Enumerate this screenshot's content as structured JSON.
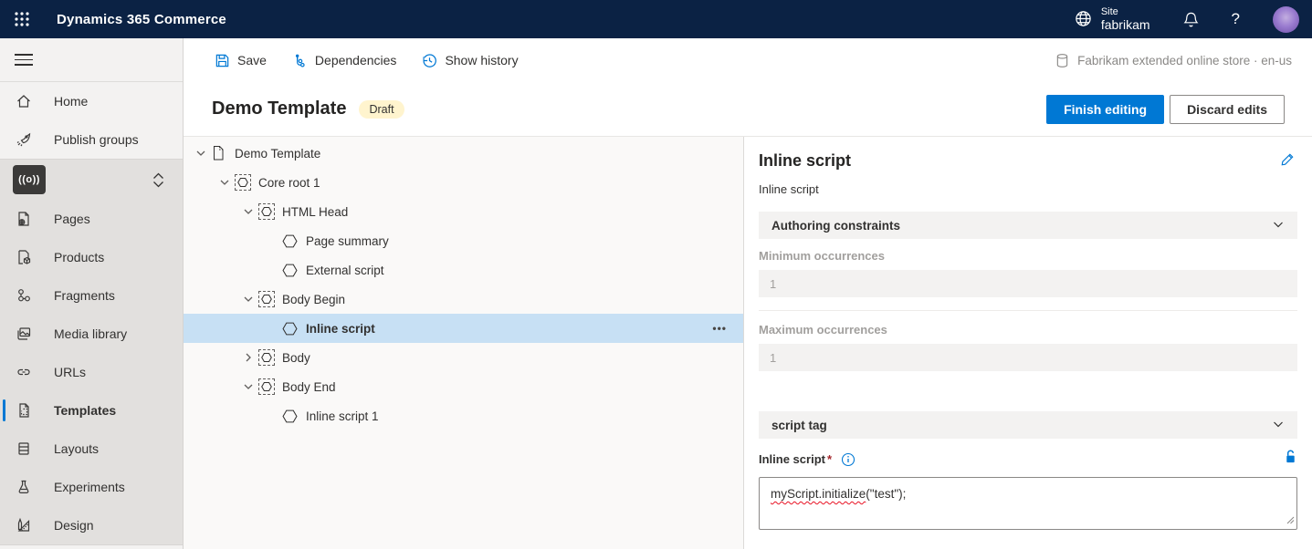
{
  "topbar": {
    "app_title": "Dynamics 365 Commerce",
    "site_label": "Site",
    "site_name": "fabrikam",
    "help_glyph": "?"
  },
  "toolbar": {
    "save_label": "Save",
    "dependencies_label": "Dependencies",
    "show_history_label": "Show history",
    "store_context": "Fabrikam extended online store · en-us"
  },
  "sidebar": {
    "channel_badge_glyph": "((o))",
    "items": [
      {
        "label": "Home"
      },
      {
        "label": "Publish groups"
      },
      {
        "label": "Pages"
      },
      {
        "label": "Products"
      },
      {
        "label": "Fragments"
      },
      {
        "label": "Media library"
      },
      {
        "label": "URLs"
      },
      {
        "label": "Templates",
        "selected": true
      },
      {
        "label": "Layouts"
      },
      {
        "label": "Experiments"
      },
      {
        "label": "Design"
      }
    ]
  },
  "page": {
    "title": "Demo Template",
    "status_badge": "Draft",
    "finish_editing_label": "Finish editing",
    "discard_edits_label": "Discard edits"
  },
  "tree": {
    "ellipsis": "•••",
    "nodes": [
      {
        "label": "Demo Template",
        "expanded": true
      },
      {
        "label": "Core root 1",
        "expanded": true
      },
      {
        "label": "HTML Head",
        "expanded": true
      },
      {
        "label": "Page summary"
      },
      {
        "label": "External script"
      },
      {
        "label": "Body Begin",
        "expanded": true
      },
      {
        "label": "Inline script",
        "selected": true
      },
      {
        "label": "Body",
        "expanded": false
      },
      {
        "label": "Body End",
        "expanded": true
      },
      {
        "label": "Inline script 1"
      }
    ]
  },
  "properties": {
    "title": "Inline script",
    "subtitle": "Inline script",
    "authoring_section_label": "Authoring constraints",
    "min_occurrences_label": "Minimum occurrences",
    "min_occurrences_value": "1",
    "max_occurrences_label": "Maximum occurrences",
    "max_occurrences_value": "1",
    "script_tag_section_label": "script tag",
    "inline_script_label": "Inline script",
    "required_mark": "*",
    "inline_script_value_flagged": "myScript.initialize",
    "inline_script_value_rest": "(\"test\");"
  },
  "colors": {
    "accent": "#0078d4",
    "topbar_bg": "#0b2244",
    "selected_row_bg": "#c7e0f4",
    "draft_badge_bg": "#fff4ce",
    "section_header_bg": "#f3f2f1"
  }
}
